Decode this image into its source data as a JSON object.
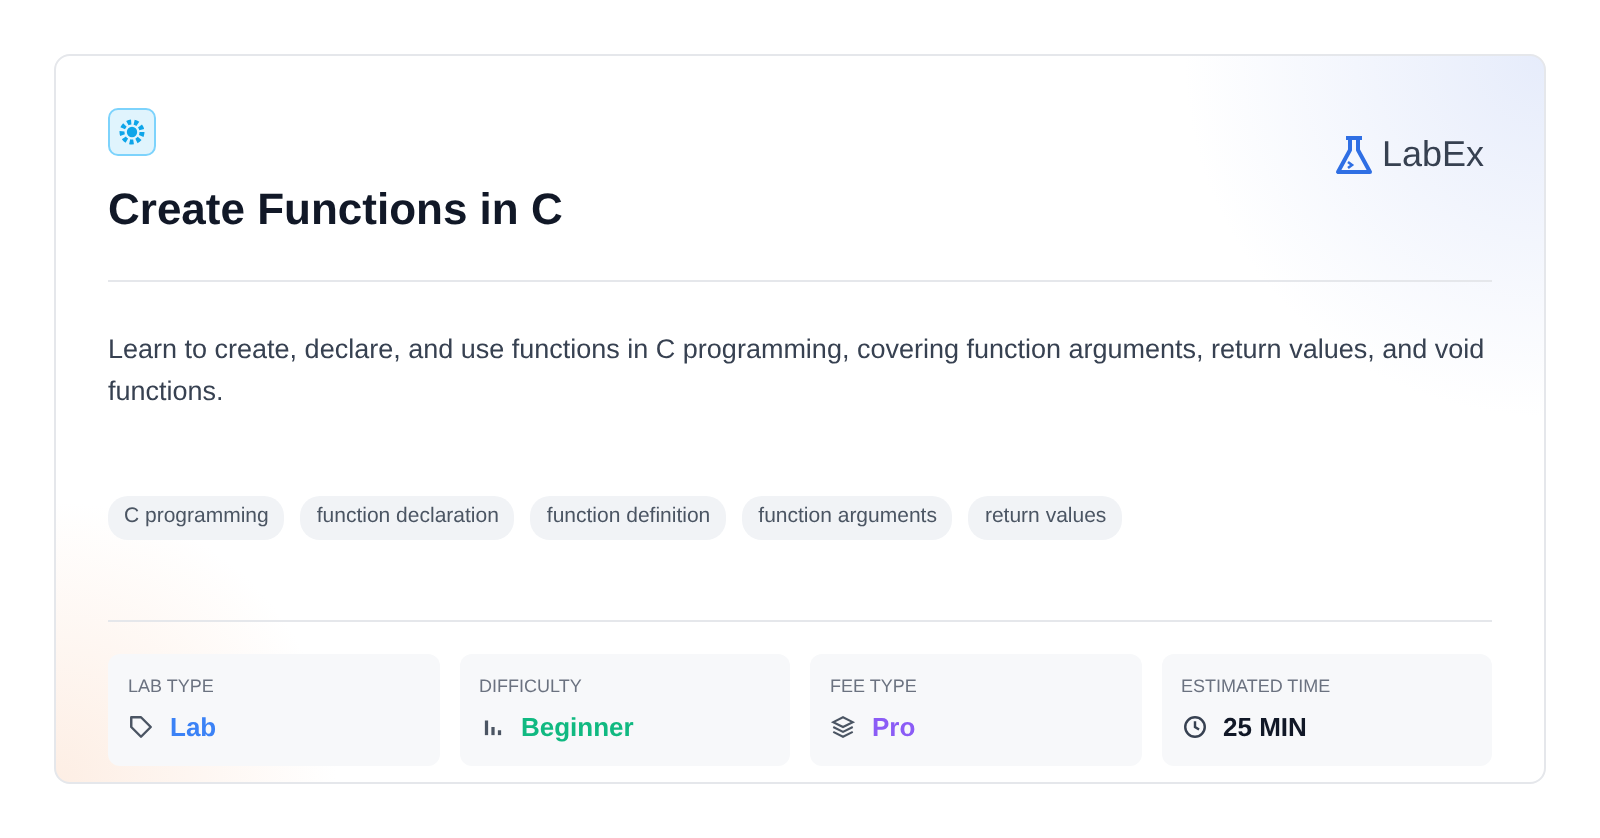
{
  "brand": {
    "name": "LabEx"
  },
  "title": "Create Functions in C",
  "description": "Learn to create, declare, and use functions in C programming, covering function arguments, return values, and void functions.",
  "tags": [
    "C programming",
    "function declaration",
    "function definition",
    "function arguments",
    "return values"
  ],
  "stats": [
    {
      "label": "LAB TYPE",
      "value": "Lab",
      "kind": "tag",
      "color": "#3b82f6"
    },
    {
      "label": "DIFFICULTY",
      "value": "Beginner",
      "kind": "bars",
      "color": "#10b981"
    },
    {
      "label": "FEE TYPE",
      "value": "Pro",
      "kind": "layers",
      "color": "#8b5cf6"
    },
    {
      "label": "ESTIMATED TIME",
      "value": "25 MIN",
      "kind": "clock",
      "color": "#111827"
    }
  ]
}
